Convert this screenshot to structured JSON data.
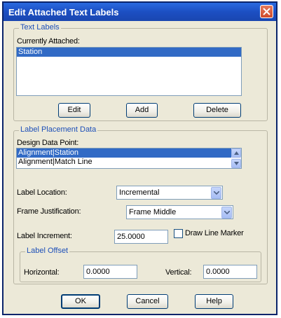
{
  "window": {
    "title": "Edit Attached Text Labels"
  },
  "text_labels": {
    "group_title": "Text Labels",
    "currently_attached_label": "Currently Attached:",
    "items": [
      "Station"
    ],
    "selected_index": 0,
    "buttons": {
      "edit": "Edit",
      "add": "Add",
      "delete": "Delete"
    }
  },
  "placement": {
    "group_title": "Label Placement Data",
    "design_data_point_label": "Design Data Point:",
    "design_data_points": [
      "Alignment|Station",
      "Alignment|Match Line"
    ],
    "selected_index": 0,
    "label_location_label": "Label Location:",
    "label_location_value": "Incremental",
    "frame_justification_label": "Frame Justification:",
    "frame_justification_value": "Frame Middle",
    "label_increment_label": "Label Increment:",
    "label_increment_value": "25.0000",
    "draw_line_marker_label": "Draw Line Marker",
    "draw_line_marker_checked": false,
    "offset": {
      "group_title": "Label Offset",
      "horizontal_label": "Horizontal:",
      "horizontal_value": "0.0000",
      "vertical_label": "Vertical:",
      "vertical_value": "0.0000"
    }
  },
  "footer": {
    "ok": "OK",
    "cancel": "Cancel",
    "help": "Help"
  },
  "colors": {
    "title_bar": "#1c4fc2",
    "selection": "#316ac5",
    "group_title": "#1d4fb8",
    "close": "#d04a2a"
  },
  "icons": {
    "close": "close-x-icon",
    "dropdown": "chevron-down-icon",
    "scroll_up": "scroll-up-arrow-icon",
    "scroll_down": "scroll-down-arrow-icon"
  }
}
